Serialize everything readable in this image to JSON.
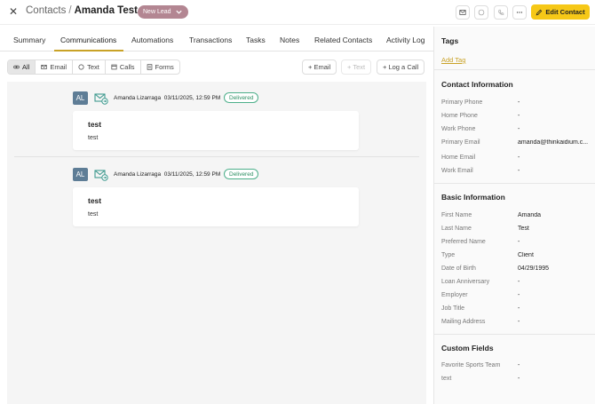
{
  "header": {
    "breadcrumb_root": "Contacts",
    "breadcrumb_sep": "/",
    "contact_name": "Amanda Test",
    "status": "New Lead",
    "edit_label": "Edit Contact"
  },
  "tabs": [
    {
      "label": "Summary"
    },
    {
      "label": "Communications"
    },
    {
      "label": "Automations"
    },
    {
      "label": "Transactions"
    },
    {
      "label": "Tasks"
    },
    {
      "label": "Notes"
    },
    {
      "label": "Related Contacts"
    },
    {
      "label": "Activity Log"
    }
  ],
  "filters": [
    {
      "label": "All",
      "icon": "link-icon"
    },
    {
      "label": "Email",
      "icon": "mail-icon"
    },
    {
      "label": "Text",
      "icon": "chat-icon"
    },
    {
      "label": "Calls",
      "icon": "calendar-icon"
    },
    {
      "label": "Forms",
      "icon": "form-icon"
    }
  ],
  "actions": {
    "email": "+ Email",
    "text": "+ Text",
    "call": "+ Log a Call"
  },
  "messages": [
    {
      "initials": "AL",
      "sender": "Amanda Lizarraga",
      "timestamp": "03/11/2025, 12:59 PM",
      "status": "Delivered",
      "subject": "test",
      "body": "test"
    },
    {
      "initials": "AL",
      "sender": "Amanda Lizarraga",
      "timestamp": "03/11/2025, 12:59 PM",
      "status": "Delivered",
      "subject": "test",
      "body": "test"
    }
  ],
  "panel": {
    "tags_title": "Tags",
    "add_tag": "Add Tag",
    "contact_title": "Contact Information",
    "contact_rows": [
      {
        "label": "Primary Phone",
        "value": "-"
      },
      {
        "label": "Home Phone",
        "value": "-"
      },
      {
        "label": "Work Phone",
        "value": "-"
      },
      {
        "label": "Primary Email",
        "value": "amanda@thinkaidium.c..."
      },
      {
        "label": "Home Email",
        "value": "-"
      },
      {
        "label": "Work Email",
        "value": "-"
      }
    ],
    "basic_title": "Basic Information",
    "basic_rows": [
      {
        "label": "First Name",
        "value": "Amanda"
      },
      {
        "label": "Last Name",
        "value": "Test"
      },
      {
        "label": "Preferred Name",
        "value": "-"
      },
      {
        "label": "Type",
        "value": "Client"
      },
      {
        "label": "Date of Birth",
        "value": "04/29/1995"
      },
      {
        "label": "Loan Anniversary",
        "value": "-"
      },
      {
        "label": "Employer",
        "value": "-"
      },
      {
        "label": "Job Title",
        "value": "-"
      },
      {
        "label": "Mailing Address",
        "value": "-"
      }
    ],
    "custom_title": "Custom Fields",
    "custom_rows": [
      {
        "label": "Favorite Sports Team",
        "value": "-"
      },
      {
        "label": "text",
        "value": "-"
      }
    ]
  },
  "colors": {
    "accent": "#f6c817",
    "status_pill": "#b38692",
    "avatar": "#5e7d96",
    "delivered": "#2d8f63",
    "link": "#c9a227"
  }
}
